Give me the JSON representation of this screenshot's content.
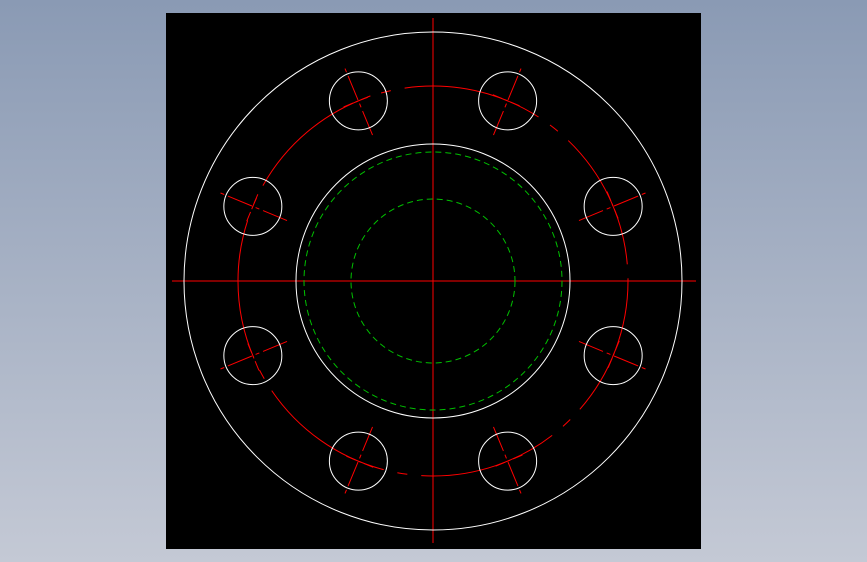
{
  "viewport": {
    "background_top": "#8a9ab4",
    "background_bottom": "#c4c9d5"
  },
  "drawing": {
    "background": "#000000",
    "colors": {
      "outline": "#ffffff",
      "centerline": "#ff0000",
      "hidden": "#00c000"
    },
    "bolt_hole_count": 8,
    "bolt_hole_angles_deg": [
      22.5,
      67.5,
      112.5,
      157.5,
      202.5,
      247.5,
      292.5,
      337.5
    ],
    "line_types": {
      "outline": "continuous",
      "centerline": "center",
      "hidden": "dashed"
    }
  }
}
